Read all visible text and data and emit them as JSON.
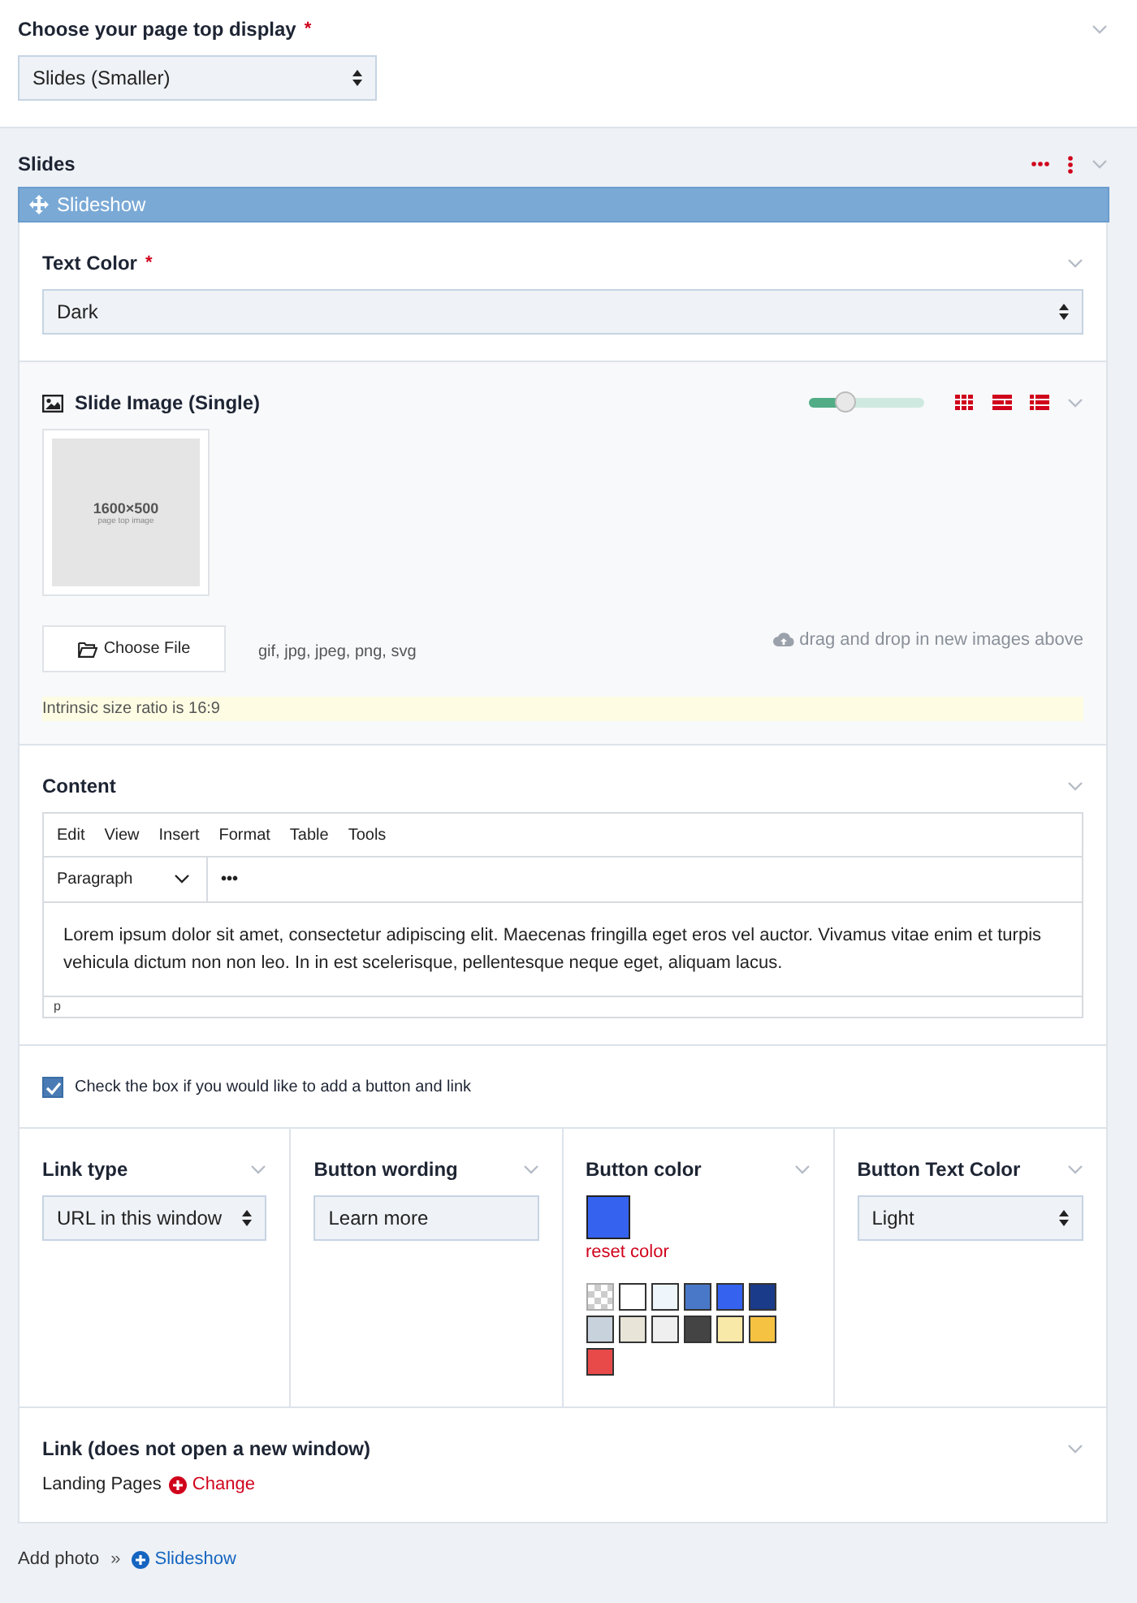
{
  "top_display": {
    "label": "Choose your page top display",
    "required_mark": "*",
    "value": "Slides (Smaller)"
  },
  "slides": {
    "title": "Slides",
    "slideshow": {
      "title": "Slideshow",
      "text_color": {
        "label": "Text Color",
        "required_mark": "*",
        "value": "Dark"
      },
      "slide_image": {
        "title": "Slide Image (Single)",
        "size_slider": {
          "level": 0.32
        },
        "view_modes": [
          {
            "kind": "grid"
          },
          {
            "kind": "details"
          },
          {
            "kind": "list"
          }
        ],
        "thumbnail": {
          "size": "1600×500",
          "caption": "page top image"
        },
        "choose_button": "Choose File",
        "file_types": "gif, jpg, jpeg, png, svg",
        "drop_hint": "drag and drop in new images above",
        "ratio_note": "Intrinsic size ratio is 16:9"
      },
      "content": {
        "label": "Content",
        "menu": [
          "Edit",
          "View",
          "Insert",
          "Format",
          "Table",
          "Tools"
        ],
        "block_format": "Paragraph",
        "more": "•••",
        "text": "Lorem ipsum dolor sit amet, consectetur adipiscing elit. Maecenas fringilla eget eros vel auctor. Vivamus vitae enim et turpis vehicula dictum non non leo. In in est scelerisque, pellentesque neque eget, aliquam lacus.",
        "path": "p"
      },
      "add_button": {
        "checked": true,
        "label": "Check the box if you would like to add a button and link"
      },
      "link_type": {
        "label": "Link type",
        "value": "URL in this window"
      },
      "button_wording": {
        "label": "Button wording",
        "value": "Learn more"
      },
      "button_color": {
        "label": "Button color",
        "color": "#3563f0",
        "reset": "reset color",
        "swatches": [
          {
            "kind": "transparent"
          },
          {
            "kind": "solid",
            "color": "#ffffff"
          },
          {
            "kind": "solid",
            "color": "#eef6fb"
          },
          {
            "kind": "solid",
            "color": "#4a78c8"
          },
          {
            "kind": "solid",
            "color": "#3563f0"
          },
          {
            "kind": "solid",
            "color": "#1a3a8a"
          },
          {
            "kind": "solid",
            "color": "#c8d2dc"
          },
          {
            "kind": "solid",
            "color": "#e8e4d8"
          },
          {
            "kind": "solid",
            "color": "#efefef"
          },
          {
            "kind": "solid",
            "color": "#444444"
          },
          {
            "kind": "solid",
            "color": "#f8e9a8"
          },
          {
            "kind": "solid",
            "color": "#f5c242"
          },
          {
            "kind": "solid",
            "color": "#e84a4a"
          }
        ]
      },
      "button_text_color": {
        "label": "Button Text Color",
        "value": "Light"
      },
      "link": {
        "label": "Link (does not open a new window)",
        "value": "Landing Pages",
        "change": "Change"
      }
    }
  },
  "footer": {
    "add": "Add photo",
    "separator": "»",
    "link": "Slideshow"
  }
}
